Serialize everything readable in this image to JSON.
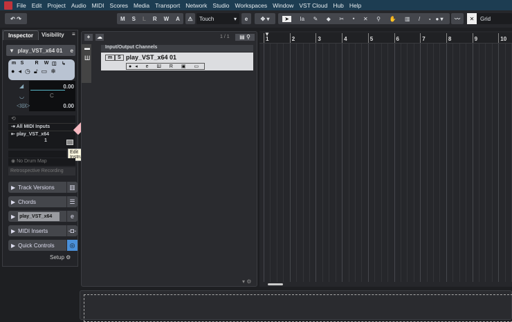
{
  "menu": [
    "File",
    "Edit",
    "Project",
    "Audio",
    "MIDI",
    "Scores",
    "Media",
    "Transport",
    "Network",
    "Studio",
    "Workspaces",
    "Window",
    "VST Cloud",
    "Hub",
    "Help"
  ],
  "toolbar": {
    "msl": [
      "M",
      "S",
      "L",
      "R",
      "W",
      "A"
    ],
    "automation_mode": "Touch",
    "snap_type": "Grid"
  },
  "inspector": {
    "tab_inspector": "Inspector",
    "tab_visibility": "Visibility",
    "track_name": "play_VST_x64 01",
    "buttons_row1": [
      "m",
      "S",
      "R",
      "W"
    ],
    "volume": "0.00",
    "pan": "C",
    "delay": "0.00",
    "input": "All MIDI Inputs",
    "output": "play_VST_x64",
    "channel": "1",
    "drum_map": "No Drum Map",
    "retro": "Retrospective Recording",
    "tooltip": "Edit Instrument",
    "sections": [
      {
        "label": "Track Versions"
      },
      {
        "label": "Chords"
      },
      {
        "label": "play_VST_x64"
      },
      {
        "label": "MIDI Inserts"
      },
      {
        "label": "Quick Controls"
      }
    ],
    "setup": "Setup"
  },
  "tracklist": {
    "count": "1 / 1",
    "folder": "Input/Output Channels",
    "track": "play_VST_x64 01",
    "track_btns": [
      "m",
      "S"
    ]
  },
  "ruler": {
    "bars": [
      "1",
      "2",
      "3",
      "4",
      "5",
      "6",
      "7",
      "8",
      "9",
      "10"
    ]
  },
  "colors": {
    "menubar": "#1d3d52",
    "accent": "#4a90d9",
    "tooltip_arrow": "#f5b8c0"
  }
}
